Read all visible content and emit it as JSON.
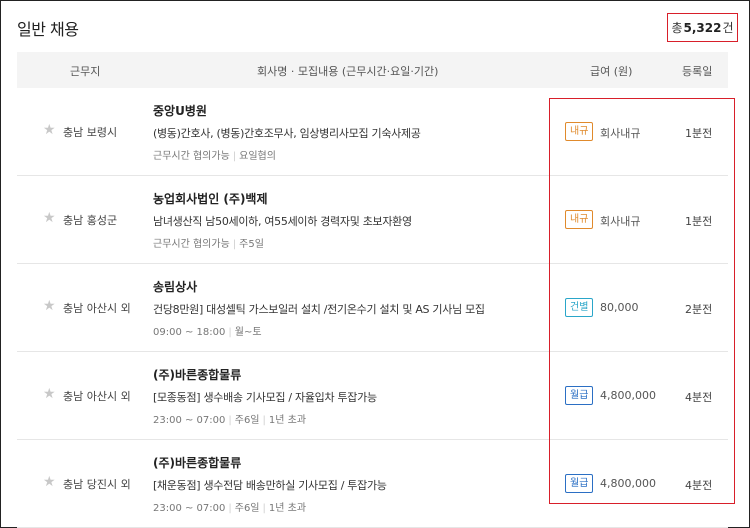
{
  "section": {
    "title": "일반 채용"
  },
  "total": {
    "prefix": "총",
    "count": "5,322",
    "suffix": "건"
  },
  "table_header": {
    "location": "근무지",
    "info": "회사명 · 모집내용 (근무시간·요일·기간)",
    "pay": "급여 (원)",
    "date": "등록일"
  },
  "rows": [
    {
      "location": "충남 보령시",
      "company": "중앙U병원",
      "title": "(병동)간호사, (병동)간호조무사, 임상병리사모집 기숙사제공",
      "meta": [
        "근무시간 협의가능",
        "요일협의"
      ],
      "pay_type": "내규",
      "pay_type_color": "#e08a2c",
      "pay": "회사내규",
      "date": "1분전"
    },
    {
      "location": "충남 홍성군",
      "company": "농업회사법인 (주)백제",
      "title": "남녀생산직 남50세이하, 여55세이하 경력자및 초보자환영",
      "meta": [
        "근무시간 협의가능",
        "주5일"
      ],
      "pay_type": "내규",
      "pay_type_color": "#e08a2c",
      "pay": "회사내규",
      "date": "1분전"
    },
    {
      "location": "충남 아산시 외",
      "company": "송림상사",
      "title": "건당8만원] 대성셀틱 가스보일러 설치 /전기온수기 설치 및 AS 기사님 모집",
      "meta": [
        "09:00 ~ 18:00",
        "월~토"
      ],
      "pay_type": "건별",
      "pay_type_color": "#2aa6c9",
      "pay": "80,000",
      "date": "2분전"
    },
    {
      "location": "충남 아산시 외",
      "company": "(주)바른종합물류",
      "title": "[모종동점] 생수배송 기사모집 / 자율입차 투잡가능",
      "meta": [
        "23:00 ~ 07:00",
        "주6일",
        "1년 초과"
      ],
      "pay_type": "월급",
      "pay_type_color": "#2b6fc4",
      "pay": "4,800,000",
      "date": "4분전"
    },
    {
      "location": "충남 당진시 외",
      "company": "(주)바른종합물류",
      "title": "[채운동점] 생수전담 배송만하실 기사모집 / 투잡가능",
      "meta": [
        "23:00 ~ 07:00",
        "주6일",
        "1년 초과"
      ],
      "pay_type": "월급",
      "pay_type_color": "#2b6fc4",
      "pay": "4,800,000",
      "date": "4분전"
    }
  ],
  "icons": {
    "favorite": "star-icon"
  },
  "colors": {
    "highlight": "#d81f2a",
    "header_bg": "#f4f4f4"
  }
}
